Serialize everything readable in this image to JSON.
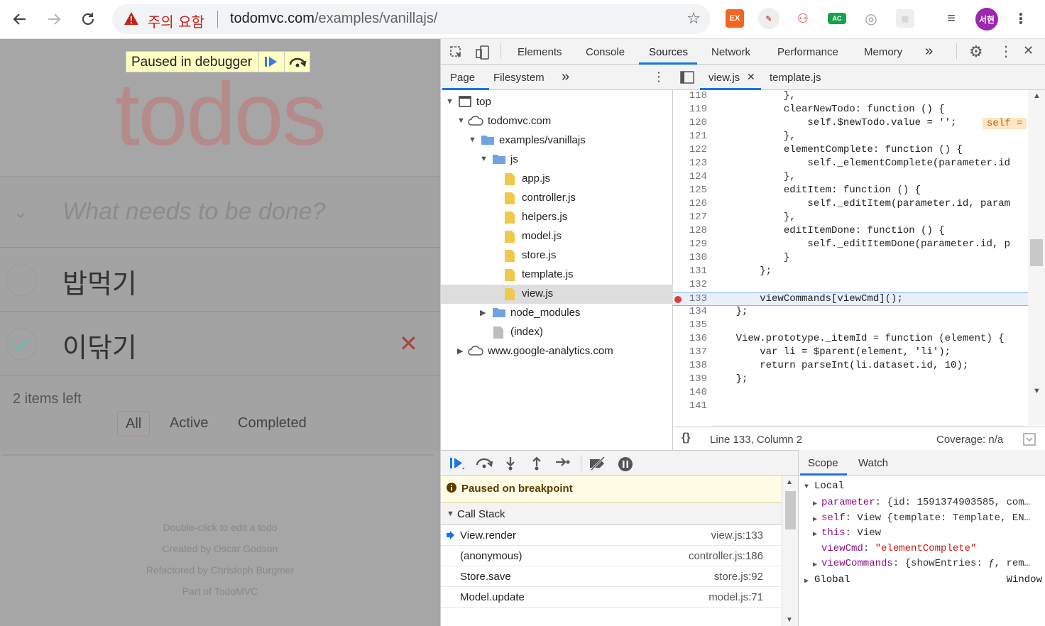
{
  "browser": {
    "warning_label": "주의 요함",
    "url_host": "todomvc.com",
    "url_path": "/examples/vanillajs/",
    "profile": "서현",
    "ext_ex": "EX",
    "ext_ac": "AC"
  },
  "page": {
    "title": "todos",
    "paused_label": "Paused in debugger",
    "new_todo_placeholder": "What needs to be done?",
    "todos": [
      {
        "text": "밥먹기",
        "completed": false
      },
      {
        "text": "이닦기",
        "completed": true
      }
    ],
    "items_left": "2 items left",
    "filters": [
      "All",
      "Active",
      "Completed"
    ],
    "selected_filter": "All",
    "info": [
      "Double-click to edit a todo",
      "Created by Oscar Godson",
      "Refactored by Christoph Burgmer",
      "Part of TodoMVC"
    ]
  },
  "devtools": {
    "tabs": [
      "Elements",
      "Console",
      "Sources",
      "Network",
      "Performance",
      "Memory"
    ],
    "active_tab": "Sources",
    "navigator_tabs": [
      "Page",
      "Filesystem"
    ],
    "tree": {
      "top": "top",
      "host": "todomvc.com",
      "folder": "examples/vanillajs",
      "js_folder": "js",
      "files": [
        "app.js",
        "controller.js",
        "helpers.js",
        "model.js",
        "store.js",
        "template.js",
        "view.js"
      ],
      "selected_file": "view.js",
      "node_modules": "node_modules",
      "index": "(index)",
      "analytics": "www.google-analytics.com"
    },
    "editor_tabs": [
      "view.js",
      "template.js"
    ],
    "code_lines": [
      {
        "n": "118",
        "src": "            },"
      },
      {
        "n": "119",
        "src": "            clearNewTodo: function () {"
      },
      {
        "n": "120",
        "src": "                self.$newTodo.value = '';"
      },
      {
        "n": "121",
        "src": "            },"
      },
      {
        "n": "122",
        "src": "            elementComplete: function () {"
      },
      {
        "n": "123",
        "src": "                self._elementComplete(parameter.id"
      },
      {
        "n": "124",
        "src": "            },"
      },
      {
        "n": "125",
        "src": "            editItem: function () {"
      },
      {
        "n": "126",
        "src": "                self._editItem(parameter.id, param"
      },
      {
        "n": "127",
        "src": "            },"
      },
      {
        "n": "128",
        "src": "            editItemDone: function () {"
      },
      {
        "n": "129",
        "src": "                self._editItemDone(parameter.id, p"
      },
      {
        "n": "130",
        "src": "            }"
      },
      {
        "n": "131",
        "src": "        };"
      },
      {
        "n": "132",
        "src": ""
      },
      {
        "n": "133",
        "src": "        viewCommands[viewCmd]();"
      },
      {
        "n": "134",
        "src": "    };"
      },
      {
        "n": "135",
        "src": ""
      },
      {
        "n": "136",
        "src": "    View.prototype._itemId = function (element) {"
      },
      {
        "n": "137",
        "src": "        var li = $parent(element, 'li');"
      },
      {
        "n": "138",
        "src": "        return parseInt(li.dataset.id, 10);"
      },
      {
        "n": "139",
        "src": "    };"
      },
      {
        "n": "140",
        "src": ""
      },
      {
        "n": "141",
        "src": ""
      }
    ],
    "current_line": "133",
    "inline_hint": "self =",
    "status_position": "Line 133, Column 2",
    "coverage": "Coverage: n/a",
    "paused_message": "Paused on breakpoint",
    "call_stack_title": "Call Stack",
    "call_stack": [
      {
        "fn": "View.render",
        "loc": "view.js:133"
      },
      {
        "fn": "(anonymous)",
        "loc": "controller.js:186"
      },
      {
        "fn": "Store.save",
        "loc": "store.js:92"
      },
      {
        "fn": "Model.update",
        "loc": "model.js:71"
      }
    ],
    "scope_tabs": [
      "Scope",
      "Watch"
    ],
    "scope": {
      "local_label": "Local",
      "parameter_key": "parameter",
      "parameter_val": "{id: 1591374903585, com…",
      "self_key": "self",
      "self_val": "View {template: Template, EN…",
      "this_key": "this",
      "this_val": "View",
      "viewcmd_key": "viewCmd",
      "viewcmd_val": "\"elementComplete\"",
      "viewcommands_key": "viewCommands",
      "viewcommands_val": "{showEntries: ƒ, rem…",
      "global_label": "Global",
      "global_val": "Window"
    }
  }
}
